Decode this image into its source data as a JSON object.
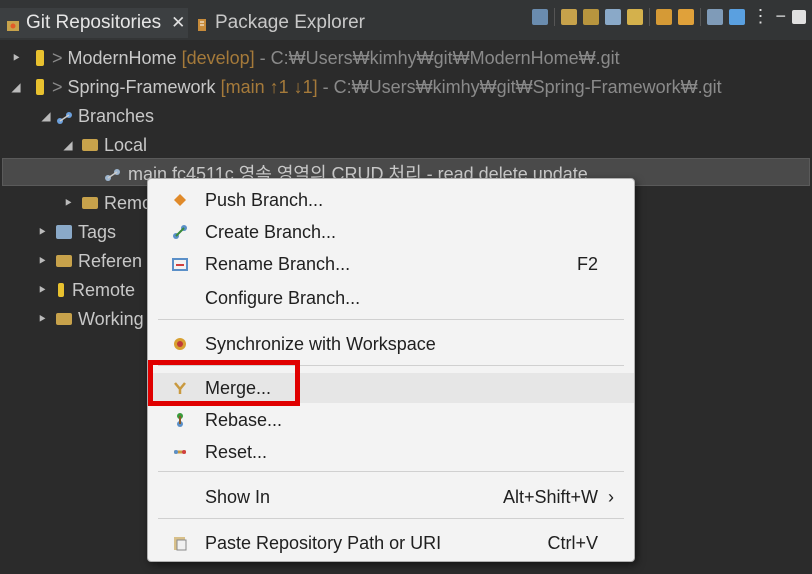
{
  "tabs": {
    "active": "Git Repositories",
    "close": "✕",
    "inactive": "Package Explorer"
  },
  "tree": {
    "repo1": {
      "name": "ModernHome",
      "branch": "[develop]",
      "path": "- C:₩Users₩kimhy₩git₩ModernHome₩.git"
    },
    "repo2": {
      "name": "Spring-Framework",
      "branch": "[main ↑1 ↓1]",
      "path": "- C:₩Users₩kimhy₩git₩Spring-Framework₩.git"
    },
    "branches": "Branches",
    "local": "Local",
    "selected_branch": "main fc4511c 영속 영역의 CRUD 처리 - read delete update",
    "remote": "Remo",
    "tags": "Tags",
    "references": "Referen",
    "remotes": "Remote",
    "working": "Working"
  },
  "menu": {
    "items": [
      {
        "label": "Push Branch...",
        "icon": "push-icon"
      },
      {
        "label": "Create Branch...",
        "icon": "create-branch-icon"
      },
      {
        "label": "Rename Branch...",
        "accel": "F2",
        "icon": "rename-icon"
      },
      {
        "label": "Configure Branch..."
      },
      {
        "label": "Synchronize with Workspace",
        "icon": "sync-icon"
      },
      {
        "label": "Merge...",
        "icon": "merge-icon"
      },
      {
        "label": "Rebase...",
        "icon": "rebase-icon"
      },
      {
        "label": "Reset...",
        "icon": "reset-icon"
      },
      {
        "label": "Show In",
        "accel": "Alt+Shift+W",
        "submenu": "›"
      },
      {
        "label": "Paste Repository Path or URI",
        "accel": "Ctrl+V",
        "icon": "paste-icon"
      }
    ]
  },
  "highlight_color": "#e00000"
}
